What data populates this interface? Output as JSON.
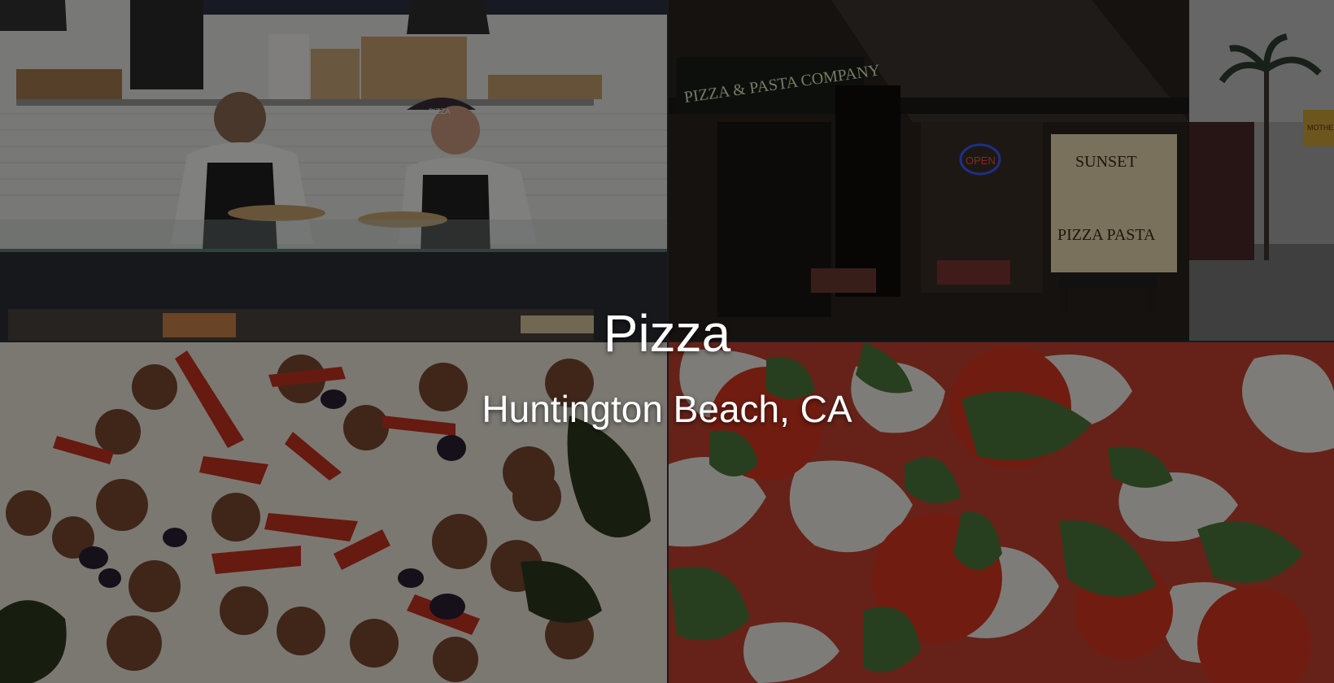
{
  "hero": {
    "title": "Pizza",
    "subtitle": "Huntington Beach, CA"
  },
  "photos": {
    "storefront": {
      "sign_left": "PIZZA & PASTA COMPANY",
      "sign_right_top": "SUNSET",
      "sign_right_bottom": "PIZZA PASTA",
      "neon": "OPEN",
      "neighbor_sign": "MOTHER'S"
    },
    "kitchen": {
      "cap_text": "PIZZA"
    }
  },
  "colors": {
    "overlay": "#000000",
    "text": "#ffffff"
  }
}
